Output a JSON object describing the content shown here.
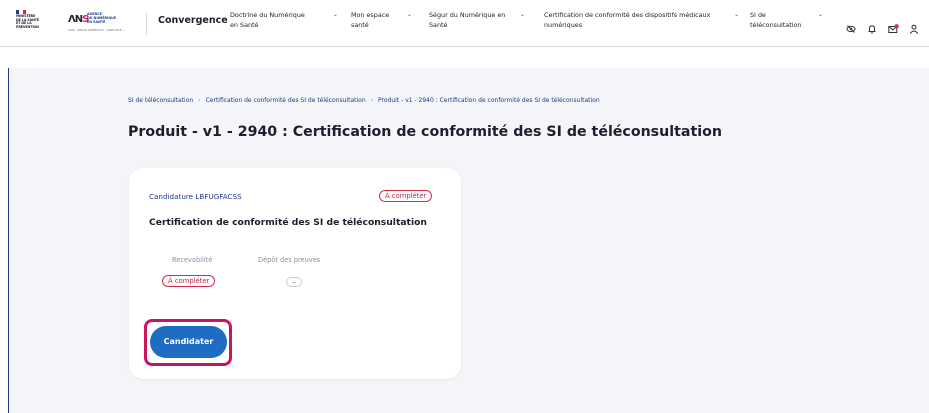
{
  "header": {
    "rf_logo_lines": [
      "MINISTÈRE",
      "DE LA SANTÉ",
      "ET DE LA PRÉVENTION"
    ],
    "ans_logo_lines": [
      "AGENCE",
      "DU NUMÉRIQUE",
      "EN SANTÉ"
    ],
    "ans_logo_tagline": "DATA · ESPACE NUMÉRIQUE · CONFIANCE ✓",
    "brand": "Convergence",
    "nav": [
      {
        "line1": "Doctrine du Numérique",
        "line2": "en Santé"
      },
      {
        "line1": "Mon espace",
        "line2": "santé"
      },
      {
        "line1": "Ségur du Numérique en",
        "line2": "Santé"
      },
      {
        "line1": "Certification de conformité des dispositifs médicaux",
        "line2": "numériques"
      },
      {
        "line1": "SI de",
        "line2": "téléconsultation"
      }
    ],
    "chevron": "⌄",
    "icons": [
      "eye-off-icon",
      "bell-icon",
      "mail-notification-icon",
      "user-icon"
    ]
  },
  "breadcrumb": {
    "items": [
      "SI de téléconsultation",
      "Certification de conformité des SI de téléconsultation",
      "Produit - v1 - 2940 : Certification de conformité des SI de téléconsultation"
    ],
    "separator": "›"
  },
  "page_title": "Produit - v1 - 2940 : Certification de conformité des SI de téléconsultation",
  "card": {
    "candidature_label": "Candidature LBFUGFACSS",
    "status_badge": "À compléter",
    "title": "Certification de conformité des SI de téléconsultation",
    "steps": [
      {
        "label": "Recevabilité",
        "status": "À compléter"
      },
      {
        "label": "Dépôt des preuves",
        "status": "–"
      }
    ],
    "cta_label": "Candidater"
  },
  "colors": {
    "accent_blue": "#1e6cc4",
    "link_blue": "#1e3a8a",
    "badge_red": "#c0233f",
    "highlight_frame": "#c8175a",
    "background": "#f4f5f8"
  }
}
